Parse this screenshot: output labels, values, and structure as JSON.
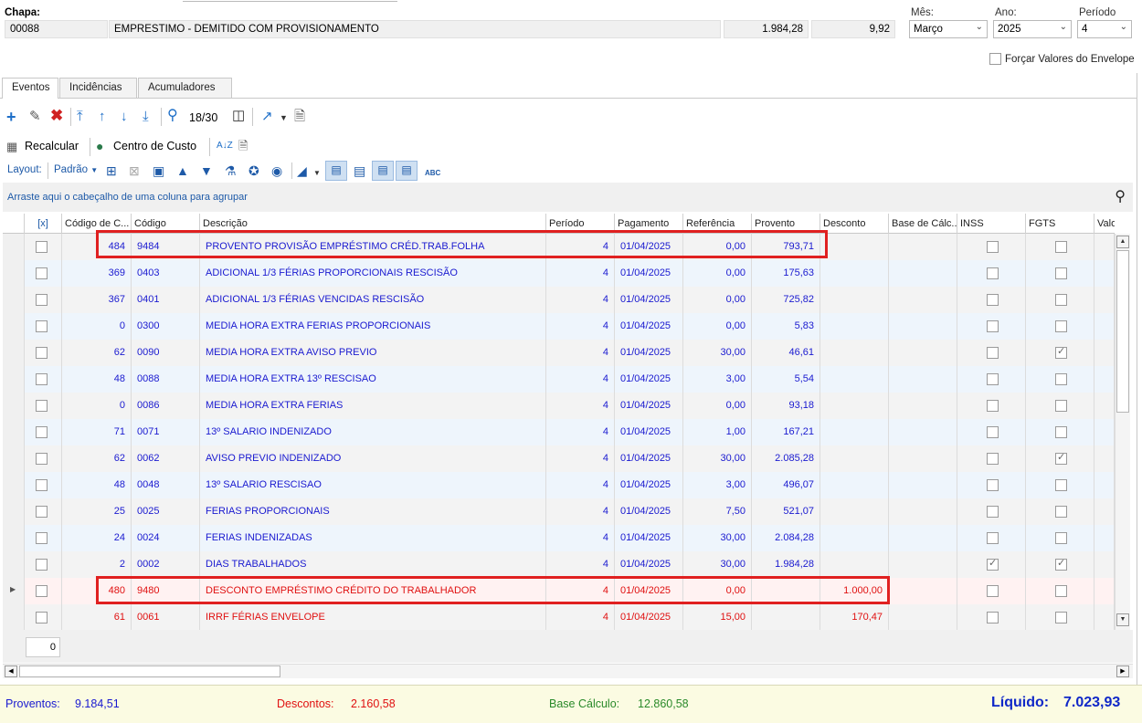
{
  "header": {
    "chapa_label": "Chapa:",
    "chapa_code": "00088",
    "employee_desc": "EMPRESTIMO - DEMITIDO COM PROVISIONAMENTO",
    "value1": "1.984,28",
    "value2": "9,92",
    "mes_label": "Mês:",
    "mes_value": "Março",
    "ano_label": "Ano:",
    "ano_value": "2025",
    "periodo_label": "Período",
    "periodo_value": "4",
    "forcar_label": "Forçar Valores do Envelope"
  },
  "tabs": [
    {
      "label": "Eventos"
    },
    {
      "label": "Incidências"
    },
    {
      "label": "Acumuladores"
    }
  ],
  "toolbar": {
    "record_counter": "18/30",
    "recalcular_label": "Recalcular",
    "centro_custo_label": "Centro de Custo",
    "layout_label": "Layout:",
    "padrao_label": "Padrão"
  },
  "group_hint": "Arraste aqui o cabeçalho de uma coluna para agrupar",
  "columns": [
    "[x]",
    "Código de C...",
    "Código",
    "Descrição",
    "Período",
    "Pagamento",
    "Referência",
    "Provento",
    "Desconto",
    "Base de Cálc...",
    "INSS",
    "FGTS",
    "Valor Fo"
  ],
  "rows": [
    {
      "cc": "484",
      "codigo": "9484",
      "descricao": "PROVENTO PROVISÃO EMPRÉSTIMO CRÉD.TRAB.FOLHA",
      "periodo": "4",
      "pagamento": "01/04/2025",
      "referencia": "0,00",
      "provento": "793,71",
      "desconto": "",
      "inss": false,
      "fgts": false,
      "kind": "provento"
    },
    {
      "cc": "369",
      "codigo": "0403",
      "descricao": "ADICIONAL 1/3 FÉRIAS PROPORCIONAIS RESCISÃO",
      "periodo": "4",
      "pagamento": "01/04/2025",
      "referencia": "0,00",
      "provento": "175,63",
      "desconto": "",
      "inss": false,
      "fgts": false,
      "kind": "provento"
    },
    {
      "cc": "367",
      "codigo": "0401",
      "descricao": "ADICIONAL 1/3 FÉRIAS VENCIDAS RESCISÃO",
      "periodo": "4",
      "pagamento": "01/04/2025",
      "referencia": "0,00",
      "provento": "725,82",
      "desconto": "",
      "inss": false,
      "fgts": false,
      "kind": "provento"
    },
    {
      "cc": "0",
      "codigo": "0300",
      "descricao": "MEDIA HORA EXTRA FERIAS PROPORCIONAIS",
      "periodo": "4",
      "pagamento": "01/04/2025",
      "referencia": "0,00",
      "provento": "5,83",
      "desconto": "",
      "inss": false,
      "fgts": false,
      "kind": "provento"
    },
    {
      "cc": "62",
      "codigo": "0090",
      "descricao": "MEDIA HORA EXTRA AVISO PREVIO",
      "periodo": "4",
      "pagamento": "01/04/2025",
      "referencia": "30,00",
      "provento": "46,61",
      "desconto": "",
      "inss": false,
      "fgts": true,
      "kind": "provento"
    },
    {
      "cc": "48",
      "codigo": "0088",
      "descricao": "MEDIA HORA EXTRA 13º RESCISAO",
      "periodo": "4",
      "pagamento": "01/04/2025",
      "referencia": "3,00",
      "provento": "5,54",
      "desconto": "",
      "inss": false,
      "fgts": false,
      "kind": "provento"
    },
    {
      "cc": "0",
      "codigo": "0086",
      "descricao": "MEDIA HORA EXTRA FERIAS",
      "periodo": "4",
      "pagamento": "01/04/2025",
      "referencia": "0,00",
      "provento": "93,18",
      "desconto": "",
      "inss": false,
      "fgts": false,
      "kind": "provento"
    },
    {
      "cc": "71",
      "codigo": "0071",
      "descricao": "13º SALARIO INDENIZADO",
      "periodo": "4",
      "pagamento": "01/04/2025",
      "referencia": "1,00",
      "provento": "167,21",
      "desconto": "",
      "inss": false,
      "fgts": false,
      "kind": "provento"
    },
    {
      "cc": "62",
      "codigo": "0062",
      "descricao": "AVISO PREVIO INDENIZADO",
      "periodo": "4",
      "pagamento": "01/04/2025",
      "referencia": "30,00",
      "provento": "2.085,28",
      "desconto": "",
      "inss": false,
      "fgts": true,
      "kind": "provento"
    },
    {
      "cc": "48",
      "codigo": "0048",
      "descricao": "13º SALARIO RESCISAO",
      "periodo": "4",
      "pagamento": "01/04/2025",
      "referencia": "3,00",
      "provento": "496,07",
      "desconto": "",
      "inss": false,
      "fgts": false,
      "kind": "provento"
    },
    {
      "cc": "25",
      "codigo": "0025",
      "descricao": "FERIAS PROPORCIONAIS",
      "periodo": "4",
      "pagamento": "01/04/2025",
      "referencia": "7,50",
      "provento": "521,07",
      "desconto": "",
      "inss": false,
      "fgts": false,
      "kind": "provento"
    },
    {
      "cc": "24",
      "codigo": "0024",
      "descricao": "FERIAS INDENIZADAS",
      "periodo": "4",
      "pagamento": "01/04/2025",
      "referencia": "30,00",
      "provento": "2.084,28",
      "desconto": "",
      "inss": false,
      "fgts": false,
      "kind": "provento"
    },
    {
      "cc": "2",
      "codigo": "0002",
      "descricao": "DIAS TRABALHADOS",
      "periodo": "4",
      "pagamento": "01/04/2025",
      "referencia": "30,00",
      "provento": "1.984,28",
      "desconto": "",
      "inss": true,
      "fgts": true,
      "kind": "provento"
    },
    {
      "cc": "480",
      "codigo": "9480",
      "descricao": "DESCONTO EMPRÉSTIMO CRÉDITO DO TRABALHADOR",
      "periodo": "4",
      "pagamento": "01/04/2025",
      "referencia": "0,00",
      "provento": "",
      "desconto": "1.000,00",
      "inss": false,
      "fgts": false,
      "kind": "desconto"
    },
    {
      "cc": "61",
      "codigo": "0061",
      "descricao": "IRRF FÉRIAS ENVELOPE",
      "periodo": "4",
      "pagamento": "01/04/2025",
      "referencia": "15,00",
      "provento": "",
      "desconto": "170,47",
      "inss": false,
      "fgts": false,
      "kind": "desconto"
    }
  ],
  "footer_count": "0",
  "summary": {
    "proventos_label": "Proventos:",
    "proventos_value": "9.184,51",
    "descontos_label": "Descontos:",
    "descontos_value": "2.160,58",
    "base_label": "Base Cálculo:",
    "base_value": "12.860,58",
    "liquido_label": "Líquido:",
    "liquido_value": "7.023,93"
  },
  "colors": {
    "provento_text": "#1a1ad0",
    "desconto_text": "#e01010",
    "highlight_box": "#e02020",
    "base_text": "#2a8a2a",
    "liquido_text": "#1028c8"
  }
}
